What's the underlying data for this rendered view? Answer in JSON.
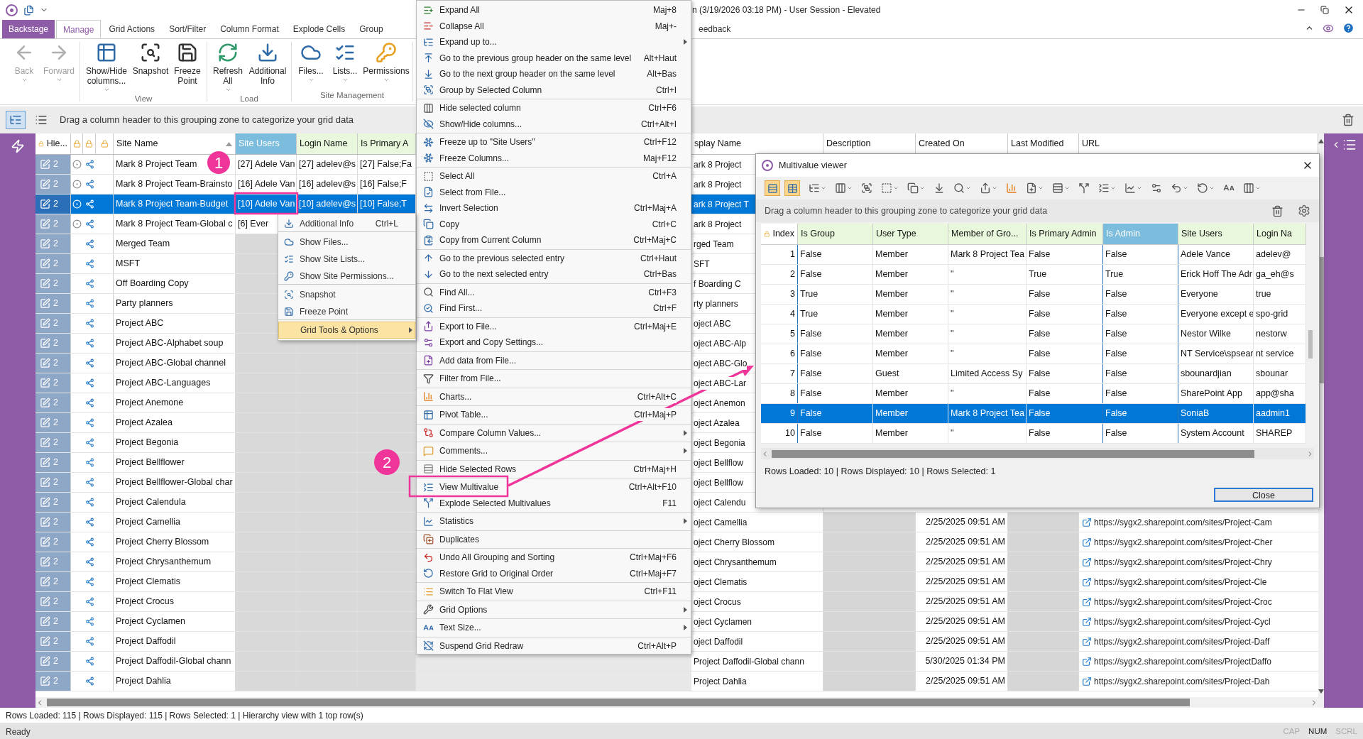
{
  "window": {
    "title": "n (3/19/2026 03:18 PM) - User Session - Elevated"
  },
  "ribbon": {
    "tabs": [
      {
        "label": "Backstage",
        "kind": "backstage",
        "selected": false
      },
      {
        "label": "Manage",
        "kind": "tab",
        "selected": true
      },
      {
        "label": "Grid Actions",
        "kind": "tab",
        "selected": false
      },
      {
        "label": "Sort/Filter",
        "kind": "tab",
        "selected": false
      },
      {
        "label": "Column Format",
        "kind": "tab",
        "selected": false
      },
      {
        "label": "Explode Cells",
        "kind": "tab",
        "selected": false
      },
      {
        "label": "Group",
        "kind": "tab",
        "selected": false
      }
    ],
    "right_tabs": [
      {
        "label": "eedback",
        "selected": false
      }
    ],
    "groups": [
      {
        "buttons": [
          {
            "label": "Back",
            "disabled": true,
            "dropdown": true
          },
          {
            "label": "Forward",
            "disabled": true,
            "dropdown": true
          }
        ]
      },
      {
        "label": "View",
        "buttons": [
          {
            "label": "Show/Hide columns...",
            "disabled": false,
            "dropdown": true
          },
          {
            "label": "Snapshot",
            "disabled": false,
            "dropdown": false
          },
          {
            "label": "Freeze Point",
            "disabled": false,
            "dropdown": false
          }
        ]
      },
      {
        "label": "Load",
        "buttons": [
          {
            "label": "Refresh All",
            "disabled": false,
            "dropdown": true
          },
          {
            "label": "Additional Info",
            "disabled": false,
            "dropdown": false
          }
        ]
      },
      {
        "label": "Site Management",
        "buttons": [
          {
            "label": "Files...",
            "disabled": false,
            "dropdown": true
          },
          {
            "label": "Lists...",
            "disabled": false,
            "dropdown": true
          },
          {
            "label": "Permissions",
            "disabled": false,
            "dropdown": true
          }
        ]
      }
    ]
  },
  "grouping_bar": {
    "hint": "Drag a column header to this grouping zone to categorize your grid data",
    "view_toggles": [
      {
        "selected": true
      },
      {
        "selected": false
      }
    ]
  },
  "grid": {
    "columns": [
      {
        "label": "Hie...",
        "color": "#ffffff",
        "selected": false
      },
      {
        "label": "Site Name",
        "color": "#ffffff",
        "selected": false,
        "sorted_ascending": true
      },
      {
        "label": "Site Users",
        "color": "#7cbcdc",
        "selected": true
      },
      {
        "label": "Login Name",
        "color": "#e9f8dc",
        "selected": false
      },
      {
        "label": "Is Primary A",
        "color": "#e9f8dc",
        "selected": false
      },
      {
        "label": "splay Name",
        "color": "#ffffff",
        "selected": false
      },
      {
        "label": "Description",
        "color": "#ffffff",
        "selected": false
      },
      {
        "label": "Created On",
        "color": "#ffffff",
        "selected": false
      },
      {
        "label": "Last Modified",
        "color": "#ffffff",
        "selected": false
      },
      {
        "label": "URL",
        "color": "#ffffff",
        "selected": false
      }
    ],
    "rows": [
      {
        "hier": "2",
        "site_name": "Mark 8 Project Team",
        "target_icon": true,
        "selected": false,
        "site_users": "[27] Adele Van",
        "login_name": "[27] adelev@s",
        "is_primary": "[27] False;Fa",
        "display_name": "ark 8 Project"
      },
      {
        "hier": "2",
        "site_name": "Mark 8 Project Team-Brainsto",
        "target_icon": true,
        "selected": false,
        "site_users": "[16] Adele Van",
        "login_name": "[16] adelev@s",
        "is_primary": "[16] False;F",
        "display_name": "ark 8 Project"
      },
      {
        "hier": "2",
        "site_name": "Mark 8 Project Team-Budget",
        "target_icon": true,
        "selected": true,
        "site_users": "[10] Adele Van",
        "login_name": "[10] adelev@s",
        "is_primary": "[10] False;T",
        "display_name": "ark 8 Project T"
      },
      {
        "hier": "2",
        "site_name": "Mark 8 Project Team-Global c",
        "target_icon": true,
        "selected": false,
        "site_users": "[6] Ever",
        "display_name": "ark 8 Project"
      },
      {
        "hier": "2",
        "site_name": "Merged Team",
        "target_icon": false,
        "selected": false,
        "display_name": "rged Team"
      },
      {
        "hier": "2",
        "site_name": "MSFT",
        "target_icon": false,
        "selected": false,
        "display_name": "SFT"
      },
      {
        "hier": "2",
        "site_name": "Off Boarding Copy",
        "target_icon": false,
        "selected": false,
        "display_name": "f Boarding C"
      },
      {
        "hier": "2",
        "site_name": "Party planners",
        "target_icon": false,
        "selected": false,
        "display_name": "rty planners"
      },
      {
        "hier": "2",
        "site_name": "Project ABC",
        "target_icon": false,
        "selected": false,
        "display_name": "oject ABC"
      },
      {
        "hier": "2",
        "site_name": "Project ABC-Alphabet soup",
        "target_icon": false,
        "selected": false,
        "display_name": "oject ABC-Alp"
      },
      {
        "hier": "2",
        "site_name": "Project ABC-Global channel",
        "target_icon": false,
        "selected": false,
        "display_name": "oject ABC-Glo"
      },
      {
        "hier": "2",
        "site_name": "Project ABC-Languages",
        "target_icon": false,
        "selected": false,
        "display_name": "oject ABC-Lar"
      },
      {
        "hier": "2",
        "site_name": "Project Anemone",
        "target_icon": false,
        "selected": false,
        "display_name": "oject Anemon"
      },
      {
        "hier": "2",
        "site_name": "Project Azalea",
        "target_icon": false,
        "selected": false,
        "display_name": "oject Azalea"
      },
      {
        "hier": "2",
        "site_name": "Project Begonia",
        "target_icon": false,
        "selected": false,
        "display_name": "oject Begonia"
      },
      {
        "hier": "2",
        "site_name": "Project Bellflower",
        "target_icon": false,
        "selected": false,
        "display_name": "oject Bellflow"
      },
      {
        "hier": "2",
        "site_name": "Project Bellflower-Global char",
        "target_icon": false,
        "selected": false,
        "display_name": "oject Bellflow"
      },
      {
        "hier": "2",
        "site_name": "Project Calendula",
        "target_icon": false,
        "selected": false,
        "display_name": "oject Calendu"
      },
      {
        "hier": "2",
        "site_name": "Project Camellia",
        "target_icon": false,
        "selected": false,
        "display_name": "oject Camellia",
        "created_on": "2/25/2025 09:51 AM",
        "url": "https://sygx2.sharepoint.com/sites/Project-Cam"
      },
      {
        "hier": "2",
        "site_name": "Project Cherry Blossom",
        "target_icon": false,
        "selected": false,
        "display_name": "oject Cherry Blossom",
        "created_on": "2/25/2025 09:51 AM",
        "url": "https://sygx2.sharepoint.com/sites/Project-Cher"
      },
      {
        "hier": "2",
        "site_name": "Project Chrysanthemum",
        "target_icon": false,
        "selected": false,
        "display_name": "oject Chrysanthemum",
        "created_on": "2/25/2025 09:51 AM",
        "url": "https://sygx2.sharepoint.com/sites/Project-Chry"
      },
      {
        "hier": "2",
        "site_name": "Project Clematis",
        "target_icon": false,
        "selected": false,
        "display_name": "oject Clematis",
        "created_on": "2/25/2025 09:51 AM",
        "url": "https://sygx2.sharepoint.com/sites/Project-Cle"
      },
      {
        "hier": "2",
        "site_name": "Project Crocus",
        "target_icon": false,
        "selected": false,
        "display_name": "oject Crocus",
        "created_on": "2/25/2025 09:51 AM",
        "url": "https://sygx2.sharepoint.com/sites/Project-Croc"
      },
      {
        "hier": "2",
        "site_name": "Project Cyclamen",
        "target_icon": false,
        "selected": false,
        "display_name": "oject Cyclamen",
        "created_on": "2/25/2025 09:51 AM",
        "url": "https://sygx2.sharepoint.com/sites/Project-Cycl"
      },
      {
        "hier": "2",
        "site_name": "Project Daffodil",
        "target_icon": false,
        "selected": false,
        "display_name": "oject Daffodil",
        "created_on": "2/25/2025 09:51 AM",
        "url": "https://sygx2.sharepoint.com/sites/Project-Daff"
      },
      {
        "hier": "2",
        "site_name": "Project Daffodil-Global chann",
        "target_icon": false,
        "selected": false,
        "display_name": "Project Daffodil-Global chann",
        "created_on": "5/30/2025 01:34 PM",
        "url": "https://sygx2.sharepoint.com/sites/ProjectDaffo"
      },
      {
        "hier": "2",
        "site_name": "Project Dahlia",
        "target_icon": false,
        "selected": false,
        "display_name": "Project Dahlia",
        "created_on": "2/25/2025 09:51 AM",
        "url": "https://sygx2.sharepoint.com/sites/Project-Dah"
      }
    ]
  },
  "status_bar": {
    "text": "Rows Loaded: 115 | Rows Displayed: 115 | Rows Selected: 1 | Hierarchy view with 1 top row(s)",
    "state": "Ready",
    "indicators": [
      {
        "label": "CAP",
        "on": false
      },
      {
        "label": "NUM",
        "on": true
      },
      {
        "label": "SCRL",
        "on": false
      }
    ]
  },
  "row_menu": {
    "items": [
      {
        "label": "Additional Info",
        "shortcut": "Ctrl+L",
        "selected": false,
        "submenu": false,
        "separator_after": true
      },
      {
        "label": "Show Files...",
        "selected": false,
        "submenu": false,
        "separator_after": false
      },
      {
        "label": "Show Site Lists...",
        "selected": false,
        "submenu": false,
        "separator_after": false
      },
      {
        "label": "Show Site Permissions...",
        "selected": false,
        "submenu": false,
        "separator_after": true
      },
      {
        "label": "Snapshot",
        "selected": false,
        "submenu": false,
        "separator_after": false
      },
      {
        "label": "Freeze Point",
        "selected": false,
        "submenu": false,
        "separator_after": true
      },
      {
        "label": "Grid Tools & Options",
        "selected": true,
        "submenu": true,
        "separator_after": false
      }
    ]
  },
  "grid_menu": {
    "groups": [
      {
        "items": [
          {
            "label": "Expand All",
            "shortcut": "Maj+8",
            "submenu": false
          },
          {
            "label": "Collapse All",
            "shortcut": "Maj+-",
            "submenu": false
          },
          {
            "label": "Expand up to...",
            "submenu": true
          },
          {
            "label": "Go to the previous group header on the same level",
            "shortcut": "Alt+Haut",
            "submenu": false
          },
          {
            "label": "Go to the next group header on the same level",
            "shortcut": "Alt+Bas",
            "submenu": false
          },
          {
            "label": "Group by Selected Column",
            "shortcut": "Ctrl+I",
            "submenu": false
          }
        ]
      },
      {
        "items": [
          {
            "label": "Hide selected column",
            "shortcut": "Ctrl+F6",
            "submenu": false
          },
          {
            "label": "Show/Hide columns...",
            "shortcut": "Ctrl+Alt+I",
            "submenu": false
          }
        ]
      },
      {
        "items": [
          {
            "label": "Freeze up to \"Site Users\"",
            "shortcut": "Ctrl+F12",
            "submenu": false
          },
          {
            "label": "Freeze Columns...",
            "shortcut": "Maj+F12",
            "submenu": false
          }
        ]
      },
      {
        "items": [
          {
            "label": "Select All",
            "shortcut": "Ctrl+A",
            "submenu": false
          },
          {
            "label": "Select from File...",
            "submenu": false
          },
          {
            "label": "Invert Selection",
            "shortcut": "Ctrl+Maj+A",
            "submenu": false
          },
          {
            "label": "Copy",
            "shortcut": "Ctrl+C",
            "submenu": false
          },
          {
            "label": "Copy from Current Column",
            "shortcut": "Ctrl+Maj+C",
            "submenu": false
          }
        ]
      },
      {
        "items": [
          {
            "label": "Go to the previous selected entry",
            "shortcut": "Ctrl+Haut",
            "submenu": false
          },
          {
            "label": "Go to the next selected entry",
            "shortcut": "Ctrl+Bas",
            "submenu": false
          }
        ]
      },
      {
        "items": [
          {
            "label": "Find All...",
            "shortcut": "Ctrl+F3",
            "submenu": false
          },
          {
            "label": "Find First...",
            "shortcut": "Ctrl+F",
            "submenu": false
          }
        ]
      },
      {
        "items": [
          {
            "label": "Export to File...",
            "shortcut": "Ctrl+Maj+E",
            "submenu": false
          },
          {
            "label": "Export and Copy Settings...",
            "submenu": false
          }
        ]
      },
      {
        "items": [
          {
            "label": "Add data from File...",
            "submenu": false
          }
        ]
      },
      {
        "items": [
          {
            "label": "Filter from File...",
            "submenu": false
          }
        ]
      },
      {
        "items": [
          {
            "label": "Charts...",
            "shortcut": "Ctrl+Alt+C",
            "submenu": false
          }
        ]
      },
      {
        "items": [
          {
            "label": "Pivot Table...",
            "shortcut": "Ctrl+Maj+P",
            "submenu": false
          }
        ]
      },
      {
        "items": [
          {
            "label": "Compare Column Values...",
            "submenu": true
          }
        ]
      },
      {
        "items": [
          {
            "label": "Comments...",
            "submenu": true
          }
        ]
      },
      {
        "items": [
          {
            "label": "Hide Selected Rows",
            "shortcut": "Ctrl+Maj+H",
            "submenu": false
          }
        ]
      },
      {
        "items": [
          {
            "label": "View Multivalue",
            "shortcut": "Ctrl+Alt+F10",
            "submenu": false
          },
          {
            "label": "Explode Selected Multivalues",
            "shortcut": "F11",
            "submenu": false
          }
        ]
      },
      {
        "items": [
          {
            "label": "Statistics",
            "submenu": true
          }
        ]
      },
      {
        "items": [
          {
            "label": "Duplicates",
            "submenu": false
          }
        ]
      },
      {
        "items": [
          {
            "label": "Undo All Grouping and Sorting",
            "shortcut": "Ctrl+Maj+F6",
            "submenu": false
          },
          {
            "label": "Restore Grid to Original Order",
            "shortcut": "Ctrl+Maj+F7",
            "submenu": false
          }
        ]
      },
      {
        "items": [
          {
            "label": "Switch To Flat View",
            "shortcut": "Ctrl+F11",
            "submenu": false
          }
        ]
      },
      {
        "items": [
          {
            "label": "Grid Options",
            "submenu": true
          }
        ]
      },
      {
        "items": [
          {
            "label": "Text Size...",
            "submenu": true
          }
        ]
      },
      {
        "items": [
          {
            "label": "Suspend Grid Redraw",
            "shortcut": "Ctrl+Alt+P",
            "submenu": false
          }
        ]
      }
    ]
  },
  "multivalue_viewer": {
    "title": "Multivalue viewer",
    "view_toggles": [
      {
        "selected": true
      },
      {
        "selected": true
      }
    ],
    "grouping_hint": "Drag a column header to this grouping zone to categorize your grid data",
    "columns": [
      {
        "label": "Index",
        "color": "#ffffff",
        "selected": false
      },
      {
        "label": "Is Group",
        "color": "#e9f8dc",
        "selected": false
      },
      {
        "label": "User Type",
        "color": "#e9f8dc",
        "selected": false
      },
      {
        "label": "Member of Gro...",
        "color": "#e9f8dc",
        "selected": false
      },
      {
        "label": "Is Primary Admin",
        "color": "#e9f8dc",
        "selected": false
      },
      {
        "label": "Is Admin",
        "color": "#7cbcdc",
        "selected": true
      },
      {
        "label": "Site Users",
        "color": "#e9f8dc",
        "selected": false
      },
      {
        "label": "Login Na",
        "color": "#e9f8dc",
        "selected": false
      }
    ],
    "rows": [
      {
        "cells": [
          "1",
          "False",
          "Member",
          "Mark 8 Project Tea",
          "False",
          "False",
          "Adele Vance",
          "adelev@"
        ],
        "selected": false
      },
      {
        "cells": [
          "2",
          "False",
          "Member",
          "\"",
          "True",
          "True",
          "Erick Hoff The Adr",
          "ga_eh@s"
        ],
        "selected": false
      },
      {
        "cells": [
          "3",
          "True",
          "Member",
          "\"",
          "False",
          "False",
          "Everyone",
          "true"
        ],
        "selected": false
      },
      {
        "cells": [
          "4",
          "True",
          "Member",
          "\"",
          "False",
          "False",
          "Everyone except e",
          "spo-grid"
        ],
        "selected": false
      },
      {
        "cells": [
          "5",
          "False",
          "Member",
          "\"",
          "False",
          "False",
          "Nestor Wilke",
          "nestorw"
        ],
        "selected": false
      },
      {
        "cells": [
          "6",
          "False",
          "Member",
          "\"",
          "False",
          "False",
          "NT Service\\spsear",
          "nt service"
        ],
        "selected": false
      },
      {
        "cells": [
          "7",
          "False",
          "Guest",
          "Limited Access Sy",
          "False",
          "False",
          "sbounardjian",
          "sbounar"
        ],
        "selected": false
      },
      {
        "cells": [
          "8",
          "False",
          "Member",
          "\"",
          "False",
          "False",
          "SharePoint App",
          "app@sha"
        ],
        "selected": false
      },
      {
        "cells": [
          "9",
          "False",
          "Member",
          "Mark 8 Project Tea",
          "False",
          "False",
          "SoniaB",
          "aadmin1"
        ],
        "selected": true
      },
      {
        "cells": [
          "10",
          "False",
          "Member",
          "\"",
          "False",
          "False",
          "System Account",
          "SHAREP"
        ],
        "selected": false
      }
    ],
    "status": "Rows Loaded: 10 | Rows Displayed: 10 | Rows Selected: 1",
    "close_button": "Close"
  },
  "annotations": [
    {
      "label": "1"
    },
    {
      "label": "2"
    }
  ]
}
